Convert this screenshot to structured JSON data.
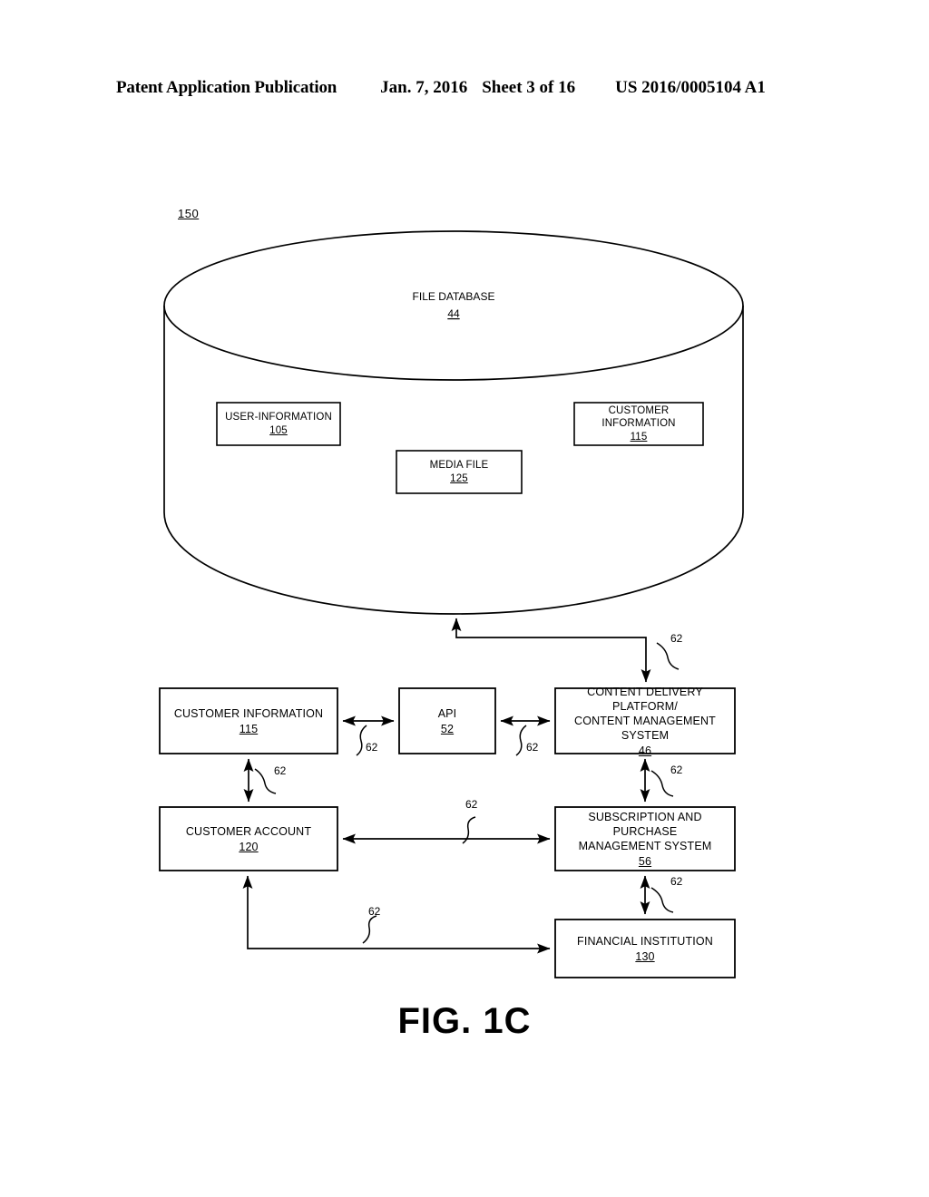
{
  "header": {
    "publication": "Patent Application Publication",
    "date": "Jan. 7, 2016",
    "sheet": "Sheet 3 of 16",
    "patent_number": "US 2016/0005104 A1"
  },
  "figure": {
    "caption": "FIG. 1C",
    "system_ref": "150",
    "database": {
      "label": "FILE DATABASE",
      "ref": "44"
    },
    "database_boxes": [
      {
        "label": "USER-INFORMATION",
        "ref": "105"
      },
      {
        "label": "MEDIA FILE",
        "ref": "125"
      },
      {
        "label": "CUSTOMER INFORMATION",
        "ref": "115"
      }
    ],
    "boxes": [
      {
        "label": "CUSTOMER INFORMATION",
        "ref": "115"
      },
      {
        "label": "API",
        "ref": "52"
      },
      {
        "label_line1": "CONTENT DELIVERY PLATFORM/",
        "label_line2": "CONTENT MANAGEMENT SYSTEM",
        "ref": "46"
      },
      {
        "label": "CUSTOMER ACCOUNT",
        "ref": "120"
      },
      {
        "label_line1": "SUBSCRIPTION AND PURCHASE",
        "label_line2": "MANAGEMENT SYSTEM",
        "ref": "56"
      },
      {
        "label": "FINANCIAL INSTITUTION",
        "ref": "130"
      }
    ],
    "connector_label": "62",
    "connectors": [
      {
        "id": "db-to-cdp",
        "label": "62"
      },
      {
        "id": "custinfo-to-api",
        "label": "62"
      },
      {
        "id": "api-to-cdp",
        "label": "62"
      },
      {
        "id": "custinfo-to-custacct",
        "label": "62"
      },
      {
        "id": "cdp-to-subscription",
        "label": "62"
      },
      {
        "id": "custacct-to-subscription",
        "label": "62"
      },
      {
        "id": "subscription-to-financial",
        "label": "62"
      },
      {
        "id": "financial-to-custacct",
        "label": "62"
      }
    ]
  },
  "colors": {
    "ink": "#000000",
    "paper": "#ffffff"
  }
}
